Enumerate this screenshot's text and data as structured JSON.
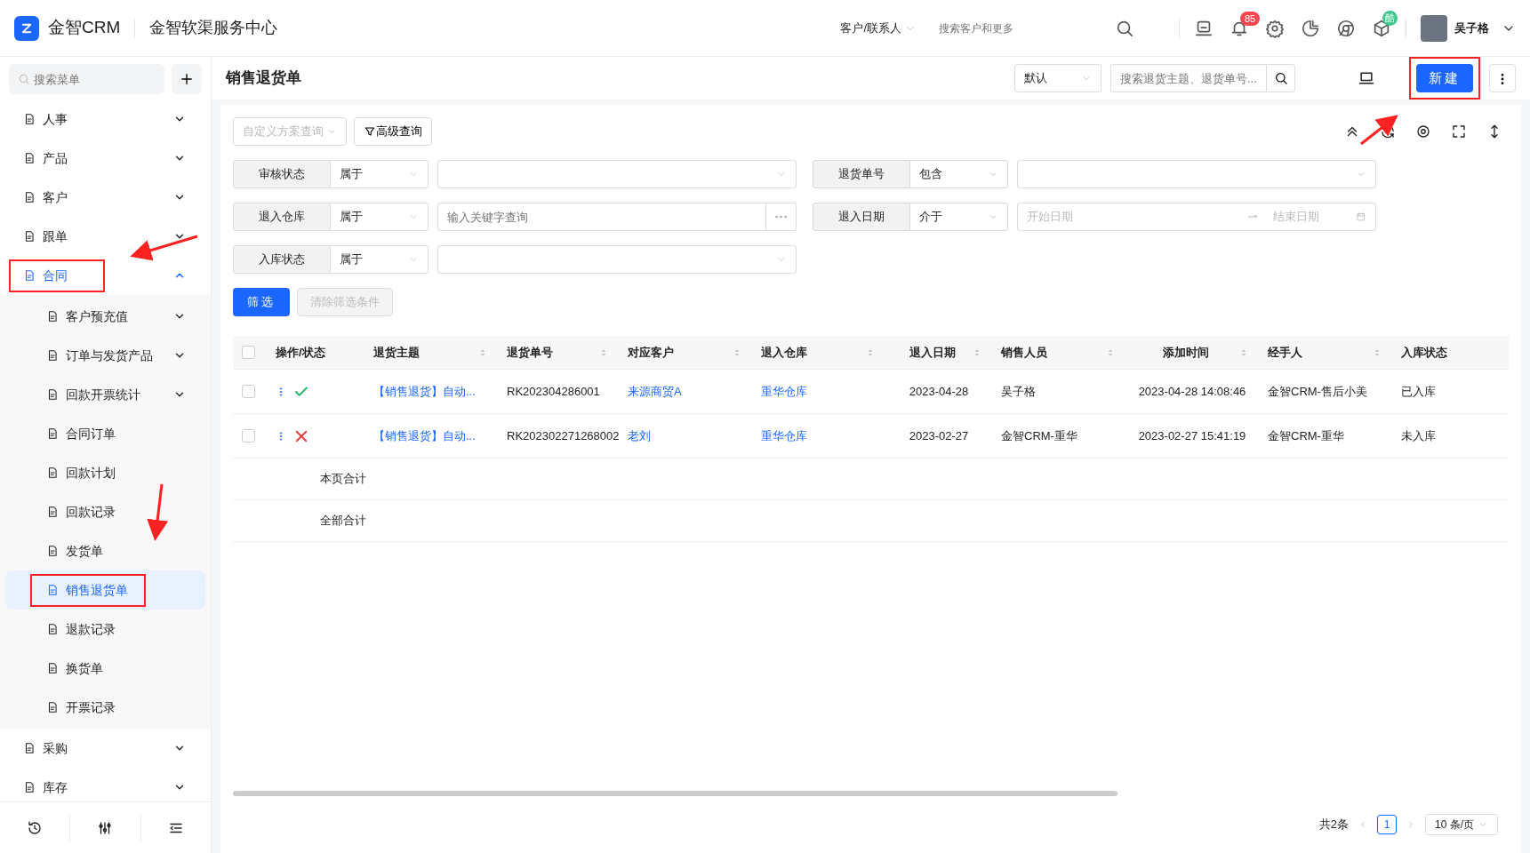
{
  "header": {
    "logo_text": "金智CRM",
    "subtitle": "金智软渠服务中心",
    "search_scope": "客户/联系人",
    "search_placeholder": "搜索客户和更多",
    "notification_count": "85",
    "app_badge": "酷",
    "user_name": "吴子格"
  },
  "sidebar": {
    "search_placeholder": "搜索菜单",
    "items": [
      {
        "label": "人事",
        "kind": "group",
        "expanded": false,
        "selected": false,
        "highlighted": false
      },
      {
        "label": "产品",
        "kind": "group",
        "expanded": false,
        "selected": false,
        "highlighted": false
      },
      {
        "label": "客户",
        "kind": "group",
        "expanded": false,
        "selected": false,
        "highlighted": false
      },
      {
        "label": "跟单",
        "kind": "group",
        "expanded": false,
        "selected": false,
        "highlighted": false
      },
      {
        "label": "合同",
        "kind": "group",
        "expanded": true,
        "selected": true,
        "highlighted": true,
        "children": [
          {
            "label": "客户预充值",
            "kind": "group",
            "expanded": false,
            "selected": false,
            "highlighted": false
          },
          {
            "label": "订单与发货产品",
            "kind": "group",
            "expanded": false,
            "selected": false,
            "highlighted": false
          },
          {
            "label": "回款开票统计",
            "kind": "group",
            "expanded": false,
            "selected": false,
            "highlighted": false
          },
          {
            "label": "合同订单",
            "kind": "link",
            "selected": false,
            "highlighted": false
          },
          {
            "label": "回款计划",
            "kind": "link",
            "selected": false,
            "highlighted": false
          },
          {
            "label": "回款记录",
            "kind": "link",
            "selected": false,
            "highlighted": false
          },
          {
            "label": "发货单",
            "kind": "link",
            "selected": false,
            "highlighted": false
          },
          {
            "label": "销售退货单",
            "kind": "link",
            "selected": true,
            "highlighted": true
          },
          {
            "label": "退款记录",
            "kind": "link",
            "selected": false,
            "highlighted": false
          },
          {
            "label": "换货单",
            "kind": "link",
            "selected": false,
            "highlighted": false
          },
          {
            "label": "开票记录",
            "kind": "link",
            "selected": false,
            "highlighted": false
          }
        ]
      },
      {
        "label": "采购",
        "kind": "group",
        "expanded": false,
        "selected": false,
        "highlighted": false
      },
      {
        "label": "库存",
        "kind": "group",
        "expanded": false,
        "selected": false,
        "highlighted": false
      }
    ]
  },
  "page": {
    "title": "销售退货单",
    "view_select": "默认",
    "search_placeholder": "搜索退货主题、退货单号...",
    "new_button": {
      "label": "新建",
      "highlighted": true
    }
  },
  "filters": {
    "scheme_placeholder": "自定义方案查询",
    "advanced_button": "高级查询",
    "rows": [
      {
        "label": "审核状态",
        "operator": "属于",
        "kind": "select"
      },
      {
        "label": "退货单号",
        "operator": "包含",
        "kind": "select"
      },
      {
        "label": "退入仓库",
        "operator": "属于",
        "kind": "lookup",
        "placeholder": "输入关键字查询"
      },
      {
        "label": "退入日期",
        "operator": "介于",
        "kind": "daterange",
        "start_placeholder": "开始日期",
        "end_placeholder": "结束日期"
      },
      {
        "label": "入库状态",
        "operator": "属于",
        "kind": "select"
      }
    ],
    "apply_button": "筛选",
    "clear_button": {
      "label": "清除筛选条件",
      "disabled": true
    }
  },
  "table": {
    "all_checked": false,
    "columns": [
      {
        "label": "操作/状态",
        "sortable": false
      },
      {
        "label": "退货主题",
        "sortable": true
      },
      {
        "label": "退货单号",
        "sortable": true
      },
      {
        "label": "对应客户",
        "sortable": true
      },
      {
        "label": "退入仓库",
        "sortable": true
      },
      {
        "label": "退入日期",
        "sortable": true
      },
      {
        "label": "销售人员",
        "sortable": true
      },
      {
        "label": "添加时间",
        "sortable": true
      },
      {
        "label": "经手人",
        "sortable": true
      },
      {
        "label": "入库状态",
        "sortable": false
      }
    ],
    "rows": [
      {
        "checked": false,
        "approved": true,
        "subject": "【销售退货】自动...",
        "number": "RK202304286001",
        "customer": "来源商贸A",
        "warehouse": "重华仓库",
        "date": "2023-04-28",
        "salesperson": "吴子格",
        "added": "2023-04-28 14:08:46",
        "handler": "金智CRM-售后小美",
        "stock_status": "已入库"
      },
      {
        "checked": false,
        "approved": false,
        "subject": "【销售退货】自动...",
        "number": "RK202302271268002",
        "customer": "老刘",
        "warehouse": "重华仓库",
        "date": "2023-02-27",
        "salesperson": "金智CRM-重华",
        "added": "2023-02-27 15:41:19",
        "handler": "金智CRM-重华",
        "stock_status": "未入库"
      }
    ],
    "totals": [
      "本页合计",
      "全部合计"
    ]
  },
  "pagination": {
    "total": "共2条",
    "pages": [
      {
        "label": "1",
        "selected": true
      }
    ],
    "page_size": "10 条/页"
  }
}
